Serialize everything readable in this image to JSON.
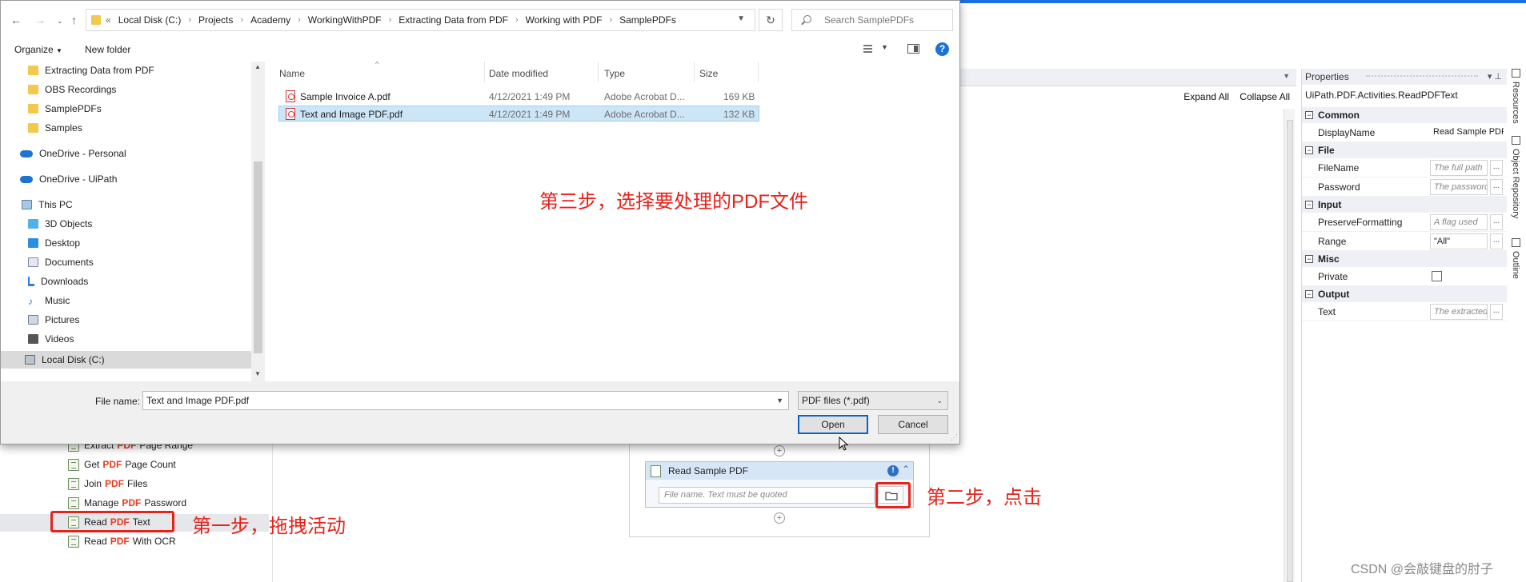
{
  "studio": {
    "toolbar_right": {
      "expand_all": "Expand All",
      "collapse_all": "Collapse All"
    },
    "activities": [
      {
        "prefix": "Extract",
        "mid": "PDF",
        "suffix": "Page Range"
      },
      {
        "prefix": "Get",
        "mid": "PDF",
        "suffix": "Page Count"
      },
      {
        "prefix": "Join",
        "mid": "PDF",
        "suffix": "Files"
      },
      {
        "prefix": "Manage",
        "mid": "PDF",
        "suffix": "Password"
      },
      {
        "prefix": "Read",
        "mid": "PDF",
        "suffix": "Text"
      },
      {
        "prefix": "Read",
        "mid": "PDF",
        "suffix": "With OCR"
      }
    ],
    "designer": {
      "activity_title": "Read Sample PDF",
      "filename_placeholder": "File name. Text must be quoted"
    },
    "properties": {
      "title": "Properties",
      "type": "UiPath.PDF.Activities.ReadPDFText",
      "categories": [
        {
          "name": "Common",
          "rows": [
            {
              "name": "DisplayName",
              "value": "Read Sample PDF"
            }
          ]
        },
        {
          "name": "File",
          "rows": [
            {
              "name": "FileName",
              "value": "The full path"
            },
            {
              "name": "Password",
              "value": "The password"
            }
          ]
        },
        {
          "name": "Input",
          "rows": [
            {
              "name": "PreserveFormatting",
              "value": "A flag used"
            },
            {
              "name": "Range",
              "value": "\"All\""
            }
          ]
        },
        {
          "name": "Misc",
          "rows": [
            {
              "name": "Private",
              "value": ""
            }
          ]
        },
        {
          "name": "Output",
          "rows": [
            {
              "name": "Text",
              "value": "The extracted"
            }
          ]
        }
      ]
    },
    "side_tabs": [
      "Resources",
      "Object Repository",
      "Outline"
    ]
  },
  "dialog": {
    "breadcrumb": [
      "Local Disk (C:)",
      "Projects",
      "Academy",
      "WorkingWithPDF",
      "Extracting Data from PDF",
      "Working with PDF",
      "SamplePDFs"
    ],
    "search_placeholder": "Search SamplePDFs",
    "organize": "Organize",
    "new_folder": "New folder",
    "nav_items": [
      {
        "label": "Extracting Data from PDF",
        "icon": "folder-icon"
      },
      {
        "label": "OBS Recordings",
        "icon": "folder-icon"
      },
      {
        "label": "SamplePDFs",
        "icon": "folder-icon"
      },
      {
        "label": "Samples",
        "icon": "folder-icon"
      },
      {
        "label": "OneDrive - Personal",
        "icon": "cloud-icon"
      },
      {
        "label": "OneDrive - UiPath",
        "icon": "cloud-icon"
      },
      {
        "label": "This PC",
        "icon": "computer-icon"
      },
      {
        "label": "3D Objects",
        "icon": "cube-icon"
      },
      {
        "label": "Desktop",
        "icon": "desktop-icon"
      },
      {
        "label": "Documents",
        "icon": "documents-icon"
      },
      {
        "label": "Downloads",
        "icon": "download-icon"
      },
      {
        "label": "Music",
        "icon": "music-icon"
      },
      {
        "label": "Pictures",
        "icon": "pictures-icon"
      },
      {
        "label": "Videos",
        "icon": "videos-icon"
      },
      {
        "label": "Local Disk (C:)",
        "icon": "disk-icon"
      }
    ],
    "columns": {
      "name": "Name",
      "date": "Date modified",
      "type": "Type",
      "size": "Size"
    },
    "files": [
      {
        "name": "Sample Invoice A.pdf",
        "date": "4/12/2021 1:49 PM",
        "type": "Adobe Acrobat D...",
        "size": "169 KB"
      },
      {
        "name": "Text and Image PDF.pdf",
        "date": "4/12/2021 1:49 PM",
        "type": "Adobe Acrobat D...",
        "size": "132 KB"
      }
    ],
    "filename_label": "File name:",
    "filename_value": "Text and Image PDF.pdf",
    "filetype": "PDF files (*.pdf)",
    "open": "Open",
    "cancel": "Cancel"
  },
  "annotations": {
    "step1": "第一步，拖拽活动",
    "step2": "第二步，点击",
    "step3": "第三步，选择要处理的PDF文件"
  },
  "watermark": "CSDN @会敲键盘的肘子",
  "colors": {
    "accent": "#e5231b",
    "selection": "#cde6f7",
    "pdf_red": "#e83c1f"
  }
}
